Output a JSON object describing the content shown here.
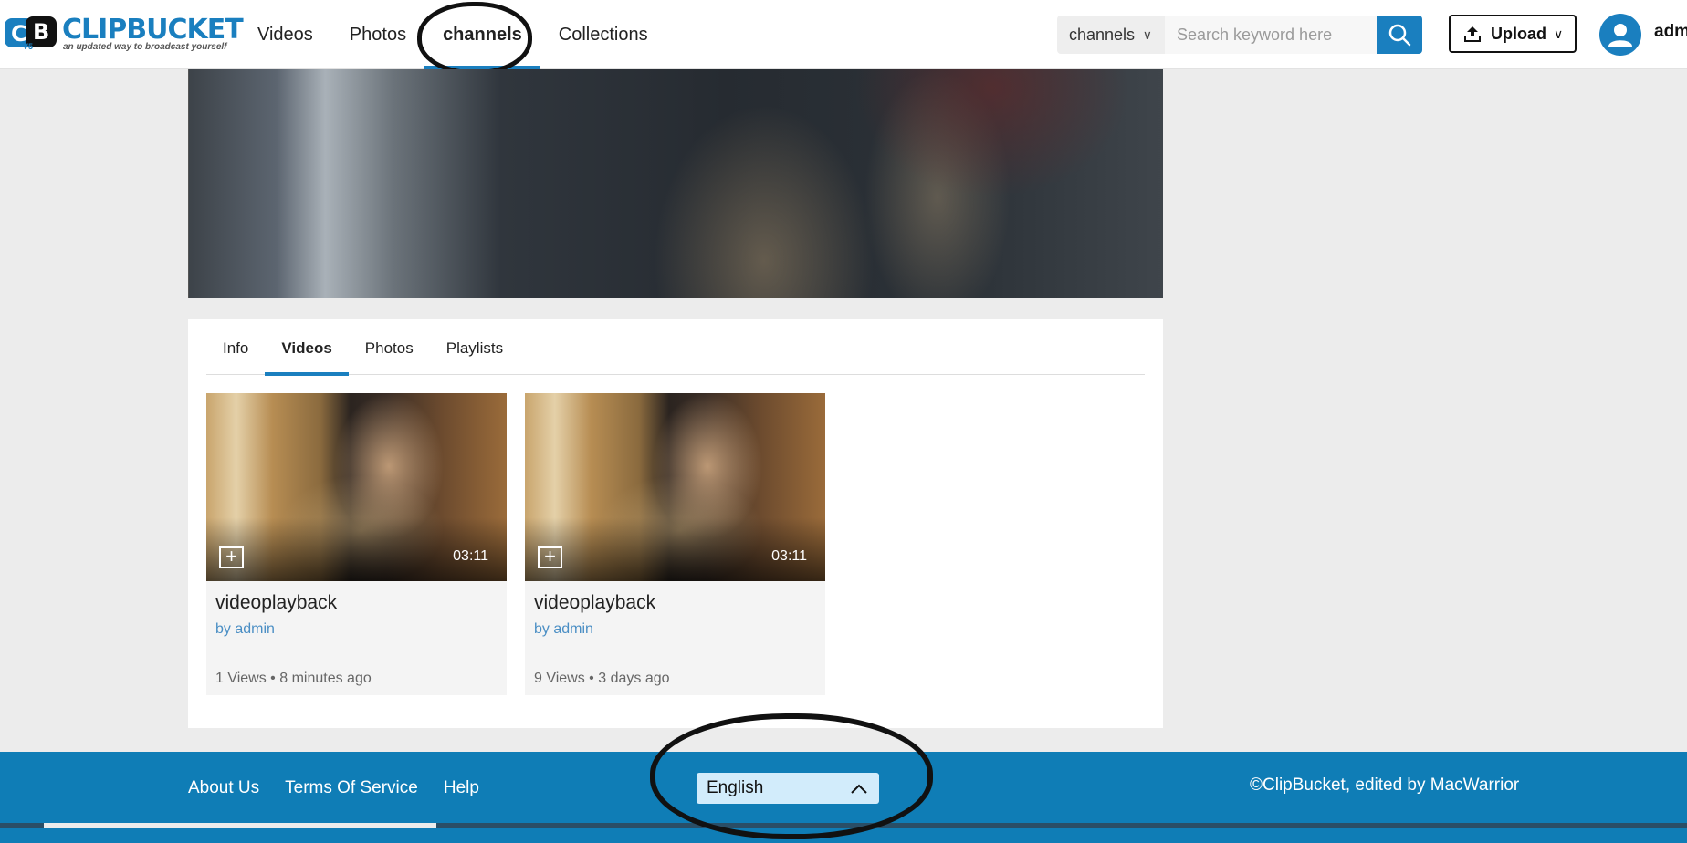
{
  "header": {
    "logo": {
      "word": "CLIPBUCKET",
      "tagline": "an updated way to broadcast yourself",
      "version": "V5",
      "letters": "CB"
    },
    "nav": [
      {
        "label": "Videos",
        "active": false
      },
      {
        "label": "Photos",
        "active": false
      },
      {
        "label": "channels",
        "active": true
      },
      {
        "label": "Collections",
        "active": false
      }
    ],
    "search": {
      "type_label": "channels",
      "placeholder": "Search keyword here",
      "value": ""
    },
    "upload_label": "Upload",
    "username": "adm"
  },
  "tabs": [
    {
      "label": "Info",
      "active": false
    },
    {
      "label": "Videos",
      "active": true
    },
    {
      "label": "Photos",
      "active": false
    },
    {
      "label": "Playlists",
      "active": false
    }
  ],
  "videos": [
    {
      "title": "videoplayback",
      "author": "by admin",
      "duration": "03:11",
      "views": "1 Views",
      "age": "8 minutes ago"
    },
    {
      "title": "videoplayback",
      "author": "by admin",
      "duration": "03:11",
      "views": "9 Views",
      "age": "3 days ago"
    }
  ],
  "footer": {
    "links": [
      "About Us",
      "Terms Of Service",
      "Help"
    ],
    "language": "English",
    "copyright": "©ClipBucket, edited by MacWarrior"
  },
  "colors": {
    "accent": "#1a7fbf",
    "footer": "#0f7db6",
    "language_bg": "#d2ecfb"
  },
  "icons": {
    "search": "search-icon",
    "upload": "upload-icon",
    "user": "user-icon",
    "add": "plus-icon",
    "dropdown": "chevron-down-icon",
    "language_toggle": "chevron-up-icon"
  }
}
